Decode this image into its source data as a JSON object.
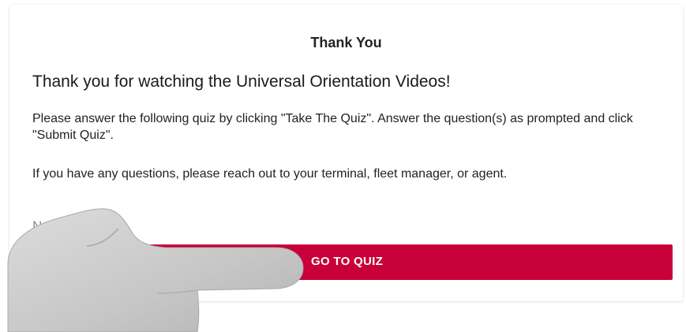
{
  "dialog": {
    "title": "Thank You",
    "heading": "Thank you for watching the Universal Orientation Videos!",
    "paragraph1": "Please answer the following quiz by clicking \"Take The Quiz\". Answer the question(s) as prompted and click \"Submit Quiz\".",
    "paragraph2": "If you have any questions, please reach out to your terminal, fleet manager, or agent.",
    "due_label": "No Due Date",
    "button_label": "GO TO QUIZ"
  },
  "colors": {
    "button_bg": "#c8003a",
    "hand": "#c9c9c9"
  },
  "icons": {
    "hand": "pointing-hand-icon"
  }
}
